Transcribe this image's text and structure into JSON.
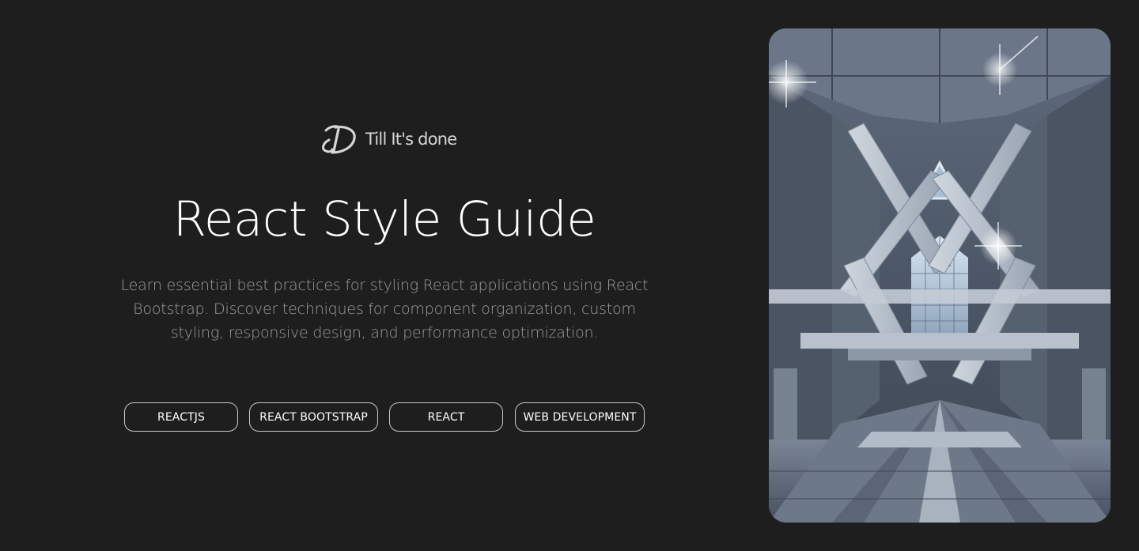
{
  "brand": {
    "name": "Till It's done",
    "logo_icon": "td-monogram-icon"
  },
  "article": {
    "title": "React Style Guide",
    "description": "Learn essential best practices for styling React applications using React Bootstrap. Discover techniques for component organization, custom styling, responsive design, and performance optimization."
  },
  "tags": [
    {
      "label": "REACTJS"
    },
    {
      "label": "REACT BOOTSTRAP"
    },
    {
      "label": "REACT"
    },
    {
      "label": "WEB DEVELOPMENT"
    }
  ],
  "hero_image": {
    "subject": "symmetrical futuristic architectural interior with geometric beams and skylights"
  },
  "colors": {
    "background": "#1e1e1e",
    "text_primary": "#ffffff",
    "text_secondary": "#9c9c9c",
    "tag_border": "#c9c9c9"
  }
}
